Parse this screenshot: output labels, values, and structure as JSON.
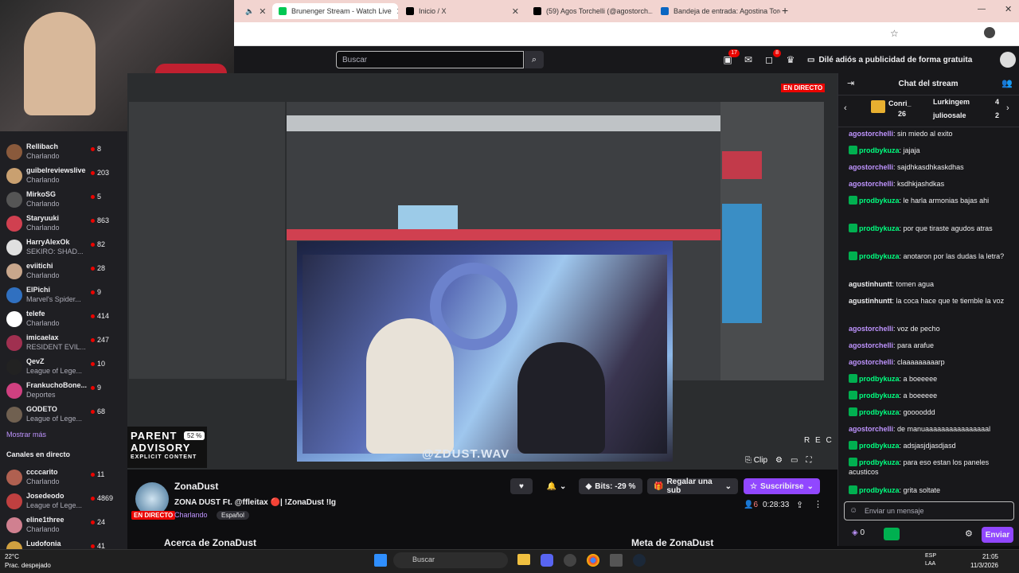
{
  "browser": {
    "tabs": [
      {
        "label": "Brunenger Stream - Watch Live",
        "color": "#00c853"
      },
      {
        "label": "Inicio / X",
        "color": "#000000"
      },
      {
        "label": "(59) Agos Torchelli (@agostorch...",
        "color": "#000000"
      },
      {
        "label": "Bandeja de entrada: Agostina Torc...",
        "color": "#0a66c2"
      }
    ],
    "new_tab": "+"
  },
  "twitch_header": {
    "search_placeholder": "Buscar",
    "notifications_count": "17",
    "whispers_count": "8",
    "adfree_label": "Dilé adiós a publicidad de forma gratuita"
  },
  "sidebar": {
    "following": [
      {
        "name": "Rellibach",
        "game": "Charlando",
        "viewers": "8",
        "color": "#8a5a3c"
      },
      {
        "name": "guibelreviewslive",
        "game": "Charlando",
        "viewers": "203",
        "color": "#c9a070"
      },
      {
        "name": "MirkoSG",
        "game": "Charlando",
        "viewers": "5",
        "color": "#555555"
      },
      {
        "name": "Staryuuki",
        "game": "Charlando",
        "viewers": "863",
        "color": "#d04050"
      },
      {
        "name": "HarryAlexOk",
        "game": "SEKIRO: SHAD...",
        "viewers": "82",
        "color": "#e0e0e0"
      },
      {
        "name": "eviitichi",
        "game": "Charlando",
        "viewers": "28",
        "color": "#c9a78c"
      },
      {
        "name": "ElPichi",
        "game": "Marvel's Spider...",
        "viewers": "9",
        "color": "#3070c0"
      },
      {
        "name": "telefe",
        "game": "Charlando",
        "viewers": "414",
        "color": "#ffffff"
      },
      {
        "name": "imicaelax",
        "game": "RESIDENT EVIL...",
        "viewers": "247",
        "color": "#a03050"
      },
      {
        "name": "QevZ",
        "game": "League of Lege...",
        "viewers": "10",
        "color": "#222222"
      },
      {
        "name": "FrankuchoBone...",
        "game": "Deportes",
        "viewers": "9",
        "color": "#d04080"
      },
      {
        "name": "GODETO",
        "game": "League of Lege...",
        "viewers": "68",
        "color": "#706050"
      }
    ],
    "show_more": "Mostrar más",
    "live_channels_title": "Canales en directo",
    "live": [
      {
        "name": "ccccarito",
        "game": "Charlando",
        "viewers": "11",
        "color": "#b06050"
      },
      {
        "name": "Josedeodo",
        "game": "League of Lege...",
        "viewers": "4869",
        "color": "#c04040"
      },
      {
        "name": "eline1three",
        "game": "Charlando",
        "viewers": "24",
        "color": "#d08090"
      },
      {
        "name": "Ludofonia",
        "game": "",
        "viewers": "41",
        "color": "#d0a040"
      }
    ]
  },
  "video": {
    "parental_line1": "PARENT",
    "parental_line2": "ADVISORY",
    "parental_line3": "EXPLICIT CONTENT",
    "volume": "52 %",
    "guest_handle": "@ZDUST.WAV",
    "rec_label": "R E C",
    "daw_live_label": "EN DIRECTO",
    "clip_label": "Clip"
  },
  "channel": {
    "name": "ZonaDust",
    "live_badge": "EN DIRECTO",
    "title": "ZONA DUST Ft. @ffleitax 🔴| !ZonaDust !Ig",
    "game": "Charlando",
    "language": "Español",
    "bits_label": "Bits: -29 %",
    "gift_label": "Regalar una sub",
    "subscribe_label": "Suscribirse",
    "viewers": "6",
    "uptime": "0:28:33",
    "about": "Acerca de ZonaDust",
    "meta": "Meta de ZonaDust"
  },
  "chat": {
    "title": "Chat del stream",
    "gifters": [
      {
        "name": "Conri_",
        "count": "26"
      },
      {
        "name": "Lurkingem",
        "count": "4"
      },
      {
        "name": "julioosale",
        "count": "2"
      }
    ],
    "messages": [
      {
        "user": "agostorchelli",
        "text": "sin miedo al exito",
        "badge": false,
        "ucolor": "#bf94ff"
      },
      {
        "user": "prodbykuza",
        "text": "jajaja",
        "badge": true,
        "ucolor": "#00ff7f"
      },
      {
        "user": "agostorchelli",
        "text": "sajdhkasdhkaskdhas",
        "badge": false,
        "ucolor": "#bf94ff"
      },
      {
        "user": "agostorchelli",
        "text": "ksdhkjashdkas",
        "badge": false,
        "ucolor": "#bf94ff"
      },
      {
        "user": "prodbykuza",
        "text": "le harla armonias bajas ahi",
        "badge": true,
        "ucolor": "#00ff7f"
      },
      {
        "user": "prodbykuza",
        "text": "por que tiraste agudos atras",
        "badge": true,
        "ucolor": "#00ff7f"
      },
      {
        "user": "prodbykuza",
        "text": "anotaron por las dudas la letra?",
        "badge": true,
        "ucolor": "#00ff7f"
      },
      {
        "user": "agustinhuntt",
        "text": "tomen agua",
        "badge": false,
        "ucolor": "#efeff1"
      },
      {
        "user": "agustinhuntt",
        "text": "la coca hace que te tiemble la voz",
        "badge": false,
        "ucolor": "#efeff1"
      },
      {
        "user": "agostorchelli",
        "text": "voz de pecho",
        "badge": false,
        "ucolor": "#bf94ff"
      },
      {
        "user": "agostorchelli",
        "text": "para arafue",
        "badge": false,
        "ucolor": "#bf94ff"
      },
      {
        "user": "agostorchelli",
        "text": "claaaaaaaaarp",
        "badge": false,
        "ucolor": "#bf94ff"
      },
      {
        "user": "prodbykuza",
        "text": "a boeeeee",
        "badge": true,
        "ucolor": "#00ff7f"
      },
      {
        "user": "prodbykuza",
        "text": "a boeeeee",
        "badge": true,
        "ucolor": "#00ff7f"
      },
      {
        "user": "prodbykuza",
        "text": "gooooddd",
        "badge": true,
        "ucolor": "#00ff7f"
      },
      {
        "user": "agostorchelli",
        "text": "de manuaaaaaaaaaaaaaaaal",
        "badge": false,
        "ucolor": "#bf94ff"
      },
      {
        "user": "prodbykuza",
        "text": "adsjasjdjasdjasd",
        "badge": true,
        "ucolor": "#00ff7f"
      },
      {
        "user": "prodbykuza",
        "text": "para eso estan los paneles acusticos",
        "badge": true,
        "ucolor": "#00ff7f"
      },
      {
        "user": "prodbykuza",
        "text": "grita soltate",
        "badge": true,
        "ucolor": "#00ff7f"
      }
    ],
    "input_placeholder": "Enviar un mensaje",
    "points": "0",
    "send_label": "Enviar"
  },
  "taskbar": {
    "temp": "22°C",
    "weather": "Prac. despejado",
    "search_placeholder": "Buscar",
    "lang1": "ESP",
    "lang2": "LAA",
    "time": "21:05",
    "date": "11/3/2026"
  }
}
